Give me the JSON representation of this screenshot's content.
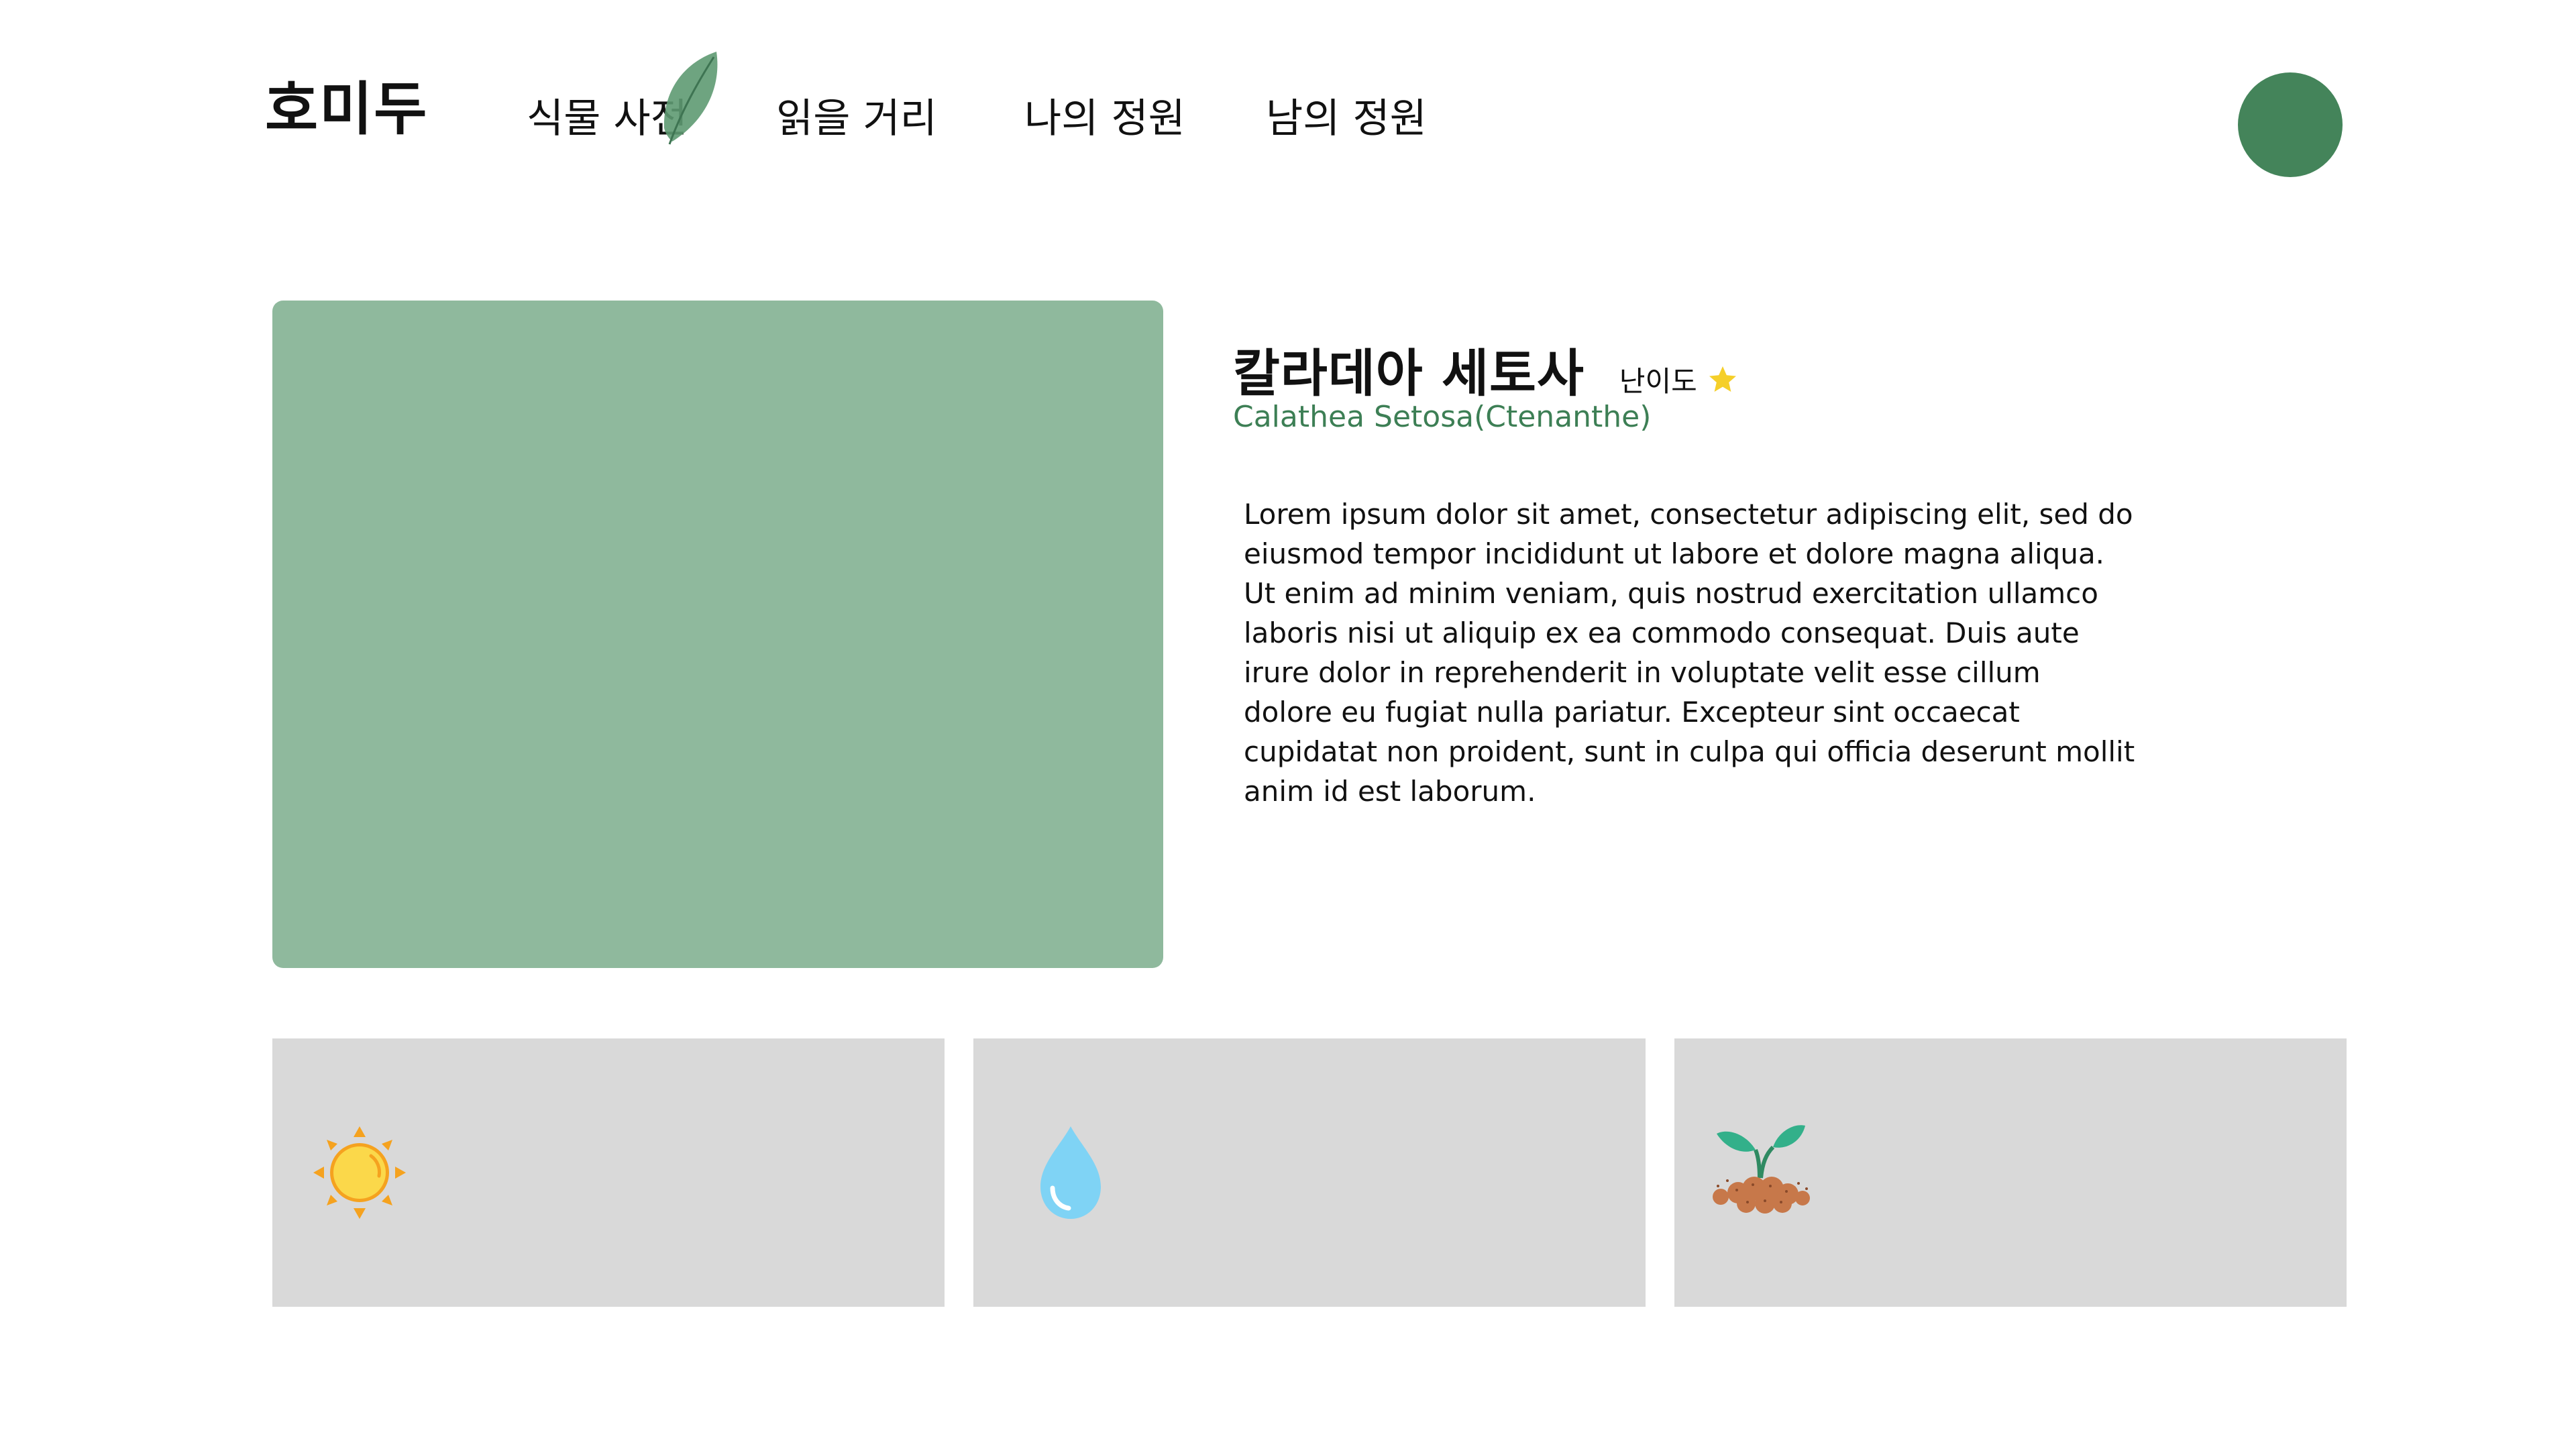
{
  "app": {
    "logo": "호미두"
  },
  "nav": {
    "items": [
      {
        "label": "식물 사전"
      },
      {
        "label": "읽을 거리"
      },
      {
        "label": "나의 정원"
      },
      {
        "label": "남의 정원"
      }
    ],
    "active_index": 0
  },
  "plant": {
    "name": "칼라데아 세토사",
    "difficulty_label": "난이도",
    "difficulty_stars": 1,
    "scientific_name": "Calathea Setosa(Ctenanthe)",
    "description": "Lorem ipsum dolor sit amet, consectetur adipiscing elit, sed do eiusmod tempor incididunt ut labore et dolore magna aliqua. Ut enim ad minim veniam, quis nostrud exercitation ullamco laboris nisi ut aliquip ex ea commodo consequat. Duis aute irure dolor in reprehenderit in voluptate velit esse cillum dolore eu fugiat nulla pariatur. Excepteur sint occaecat cupidatat non proident, sunt in culpa qui officia deserunt mollit anim id est laborum."
  },
  "care_cards": [
    {
      "icon": "sun-icon"
    },
    {
      "icon": "water-drop-icon"
    },
    {
      "icon": "soil-sprout-icon"
    }
  ],
  "colors": {
    "accent_green": "#44845a",
    "image_placeholder": "#8fb99d",
    "scientific_text": "#3d7f55",
    "card_bg": "#d9d9d9",
    "star": "#f5cf2a"
  }
}
